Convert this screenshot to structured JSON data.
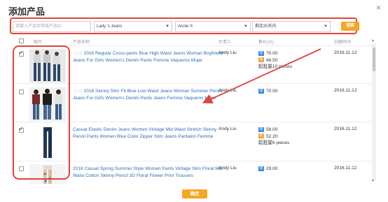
{
  "dialog": {
    "title": "添加产品",
    "close_label": "×"
  },
  "filters": {
    "search_placeholder": "请输入产品名称或产品ID",
    "category": "Lady 's Jeans",
    "owner": "Annie S",
    "period": "剩余30天内",
    "search_button": "搜索"
  },
  "table": {
    "headers": [
      "图片",
      "产品名称",
      "负责人",
      "售价(元)",
      "创建时间"
    ],
    "rows": [
      {
        "checked": true,
        "name_prefix": "1116",
        "name": "2016 Regular Cross-pants Blue High Waist Jeans Woman Boyfriend Jeans For Girls Women's Denim Pants Femme Vaqueros Mujer",
        "owner": "Andy Liu",
        "price": "70.00",
        "price2": "66.50",
        "moq": "起批量10 pieces",
        "date": "2016.11.12"
      },
      {
        "checked": false,
        "name_prefix": "1116",
        "name": "2016 Skinny Slim Fit Blue Low Waist Jeans Woman Summer Pencil Jeans For Girls Women's Denim Pants Jeans Femme Vaqueros Mujer",
        "owner": "Andy Liu",
        "price": "70.00",
        "price2": "",
        "moq": "",
        "date": "2016.11.12"
      },
      {
        "checked": true,
        "name_prefix": "",
        "name": "Casual Elastic Denim Jeans Women Vintage Mid Waist Stretch Skinny Pencil Pants Women Blue Color Zipper Slim Jeans Pantalon Femme",
        "owner": "Andy Liu",
        "price": "58.00",
        "price2": "52.20",
        "moq": "起批量6 pieces",
        "date": "2016.11.12"
      },
      {
        "checked": false,
        "name_prefix": "",
        "name": "2016 Casual Spring Summer Style Women Pants Vintage Slim Floral Mid Waist Cotton Skinny Pencil 3D Floral Flower Print Trousers",
        "owner": "Andy Liu",
        "price": "29.00",
        "price2": "",
        "moq": "",
        "date": "2016.11.12"
      }
    ]
  },
  "footer": {
    "ok_button": "确定"
  },
  "colors": {
    "accent": "#f5a623",
    "annotation": "#e0443b",
    "link": "#2a6ebb"
  }
}
